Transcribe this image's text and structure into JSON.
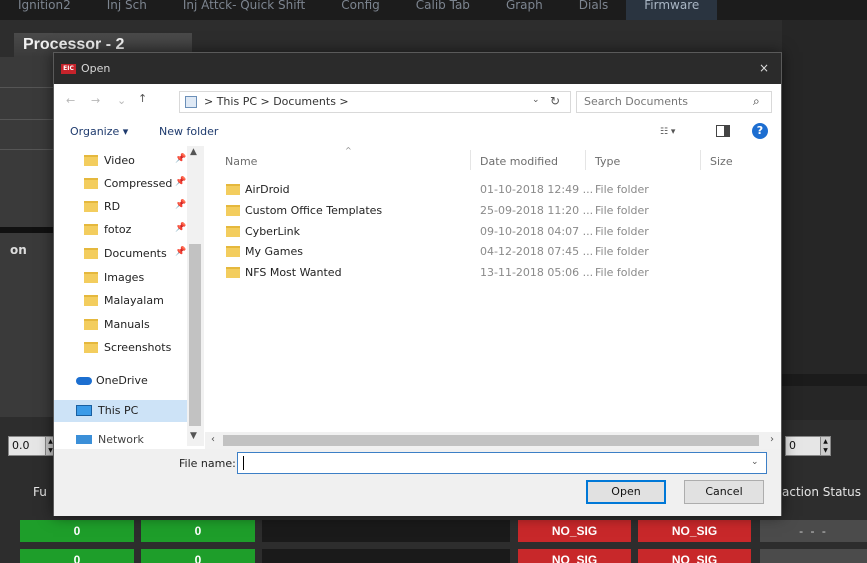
{
  "app": {
    "tabs": [
      "Ignition2",
      "Inj Sch",
      "Inj Attck- Quick Shift",
      "Config",
      "Calib Tab",
      "Graph",
      "Dials",
      "Firmware"
    ],
    "processor_title": "Processor - 2",
    "side_label": "on",
    "spin_left_value": "0.0",
    "spin_right_value": "0",
    "fu_label": "Fu",
    "action_status_label": "action Status",
    "row1": [
      "0",
      "0",
      "NO_SIG",
      "NO_SIG",
      "- - -"
    ],
    "row2": [
      "0",
      "0",
      "NO_SIG",
      "NO_SIG"
    ]
  },
  "dialog": {
    "title": "Open",
    "close_glyph": "×",
    "nav": {
      "back": "←",
      "forward": "→",
      "recent": "⌄",
      "up": "↑"
    },
    "breadcrumb": "> This PC > Documents >",
    "search_placeholder": "Search Documents",
    "toolbar": {
      "organize": "Organize ▾",
      "new_folder": "New folder",
      "help": "?"
    },
    "nav_pane": [
      {
        "label": "Video",
        "pinned": true
      },
      {
        "label": "Compressed",
        "pinned": true
      },
      {
        "label": "RD",
        "pinned": true
      },
      {
        "label": "fotoz",
        "pinned": true
      },
      {
        "label": "Documents",
        "pinned": true
      },
      {
        "label": "Images",
        "pinned": false
      },
      {
        "label": "Malayalam",
        "pinned": false
      },
      {
        "label": "Manuals",
        "pinned": false
      },
      {
        "label": "Screenshots",
        "pinned": false
      }
    ],
    "onedrive": "OneDrive",
    "this_pc": "This PC",
    "network": "Network",
    "columns": {
      "name": "Name",
      "date": "Date modified",
      "type": "Type",
      "size": "Size"
    },
    "files": [
      {
        "name": "AirDroid",
        "date": "01-10-2018 12:49 ...",
        "type": "File folder"
      },
      {
        "name": "Custom Office Templates",
        "date": "25-09-2018 11:20 ...",
        "type": "File folder"
      },
      {
        "name": "CyberLink",
        "date": "09-10-2018 04:07 ...",
        "type": "File folder"
      },
      {
        "name": "My Games",
        "date": "04-12-2018 07:45 ...",
        "type": "File folder"
      },
      {
        "name": "NFS Most Wanted",
        "date": "13-11-2018 05:06 ...",
        "type": "File folder"
      }
    ],
    "file_name_label": "File name:",
    "file_name_value": "",
    "open_button": "Open",
    "cancel_button": "Cancel"
  },
  "colors": {
    "accent": "#0078d7",
    "ok_cell": "#1e9e2a",
    "alert_cell": "#c8282a",
    "folder": "#f3cd5e"
  }
}
